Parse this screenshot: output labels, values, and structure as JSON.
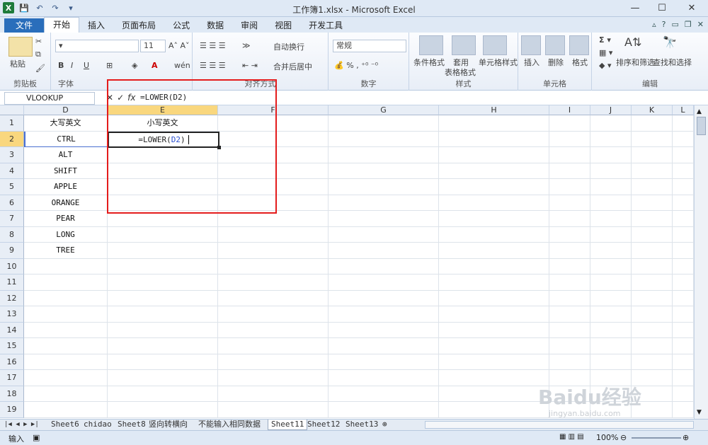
{
  "window": {
    "title": "工作簿1.xlsx - Microsoft Excel"
  },
  "ribbon_tabs": [
    "文件",
    "开始",
    "插入",
    "页面布局",
    "公式",
    "数据",
    "审阅",
    "视图",
    "开发工具"
  ],
  "ribbon": {
    "clipboard": {
      "label": "剪贴板",
      "paste": "粘贴"
    },
    "font": {
      "label": "字体",
      "size": "11",
      "bold": "B",
      "italic": "I",
      "underline": "U"
    },
    "alignment": {
      "label": "对齐方式",
      "wrap": "自动换行",
      "merge": "合并后居中"
    },
    "number": {
      "label": "数字",
      "format": "常规"
    },
    "styles": {
      "label": "样式",
      "cond": "条件格式",
      "table1": "套用",
      "table2": "表格格式",
      "cellstyle": "单元格样式"
    },
    "cells": {
      "label": "单元格",
      "insert": "插入",
      "delete": "删除",
      "format": "格式"
    },
    "editing": {
      "label": "编辑",
      "sort": "排序和筛选",
      "find": "查找和选择"
    }
  },
  "formula_bar": {
    "name_box": "VLOOKUP",
    "formula": "=LOWER(D2)"
  },
  "columns": [
    "D",
    "E",
    "F",
    "G",
    "H",
    "I",
    "J",
    "K",
    "L"
  ],
  "rows": [
    "1",
    "2",
    "3",
    "4",
    "5",
    "6",
    "7",
    "8",
    "9",
    "10",
    "11",
    "12",
    "13",
    "14",
    "15",
    "16",
    "17",
    "18",
    "19"
  ],
  "cells": {
    "d": [
      "大写英文",
      "CTRL",
      "ALT",
      "SHIFT",
      "APPLE",
      "ORANGE",
      "PEAR",
      "LONG",
      "TREE"
    ],
    "e1": "小写英文",
    "e2_prefix": "=LOWER(",
    "e2_ref": "D2",
    "e2_suffix": ")"
  },
  "sheets": [
    "Sheet6",
    "chidao",
    "Sheet8",
    "竖向转横向",
    "不能输入相同数据",
    "Sheet11",
    "Sheet12",
    "Sheet13"
  ],
  "status": {
    "mode": "输入",
    "zoom": "100%"
  },
  "watermark": {
    "text": "Baidu经验",
    "url": "jingyan.baidu.com"
  }
}
